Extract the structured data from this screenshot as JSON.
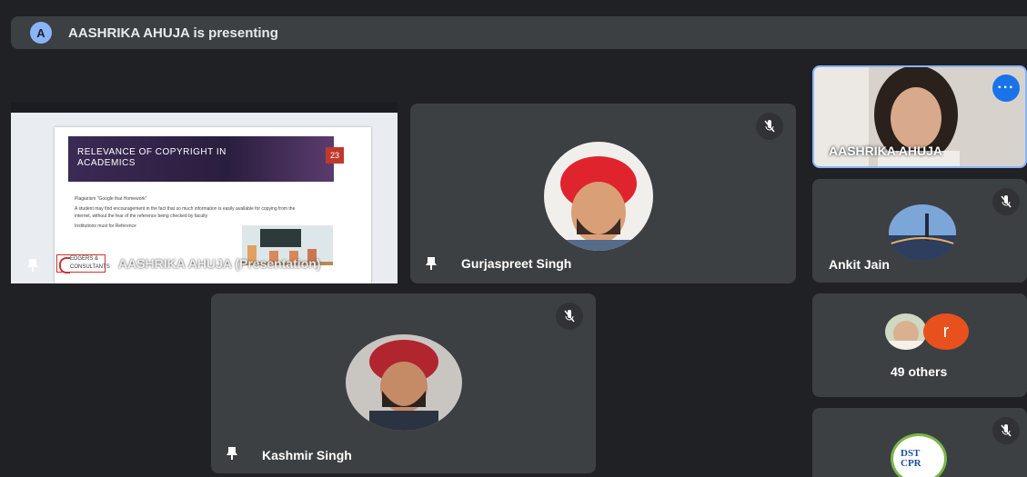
{
  "header": {
    "avatar_letter": "A",
    "presenting_text": "AASHRIKA AHUJA is presenting"
  },
  "presentation": {
    "label": "AASHRIKA AHUJA (Presentation)",
    "slide": {
      "title_line1": "RELEVANCE OF COPYRIGHT IN",
      "title_line2": "ACADEMICS",
      "number": "23",
      "bullets": [
        "Plagiarism \"Google that Homework\"",
        "A student may find encouragement in the fact that so much information is easily available for copying from the internet, without the fear of the reference being checked by faculty",
        "Institutions must for Reference"
      ],
      "logo_text_line1": "EDGERS &",
      "logo_text_line2": "CONSULTANTS"
    }
  },
  "participants": [
    {
      "name": "Gurjaspreet Singh"
    },
    {
      "name": "Kashmir Singh"
    },
    {
      "name": "AASHRIKA AHUJA"
    },
    {
      "name": "Ankit Jain"
    },
    {
      "name": "49 others",
      "avatar_letter": "r"
    },
    {
      "name": "DST-CPR",
      "logo_line1": "DST",
      "logo_line2": "CPR"
    }
  ],
  "colors": {
    "background": "#1f2125",
    "tile": "#3c4043",
    "accent": "#1a73e8",
    "others_avatar": "#e8511d"
  }
}
